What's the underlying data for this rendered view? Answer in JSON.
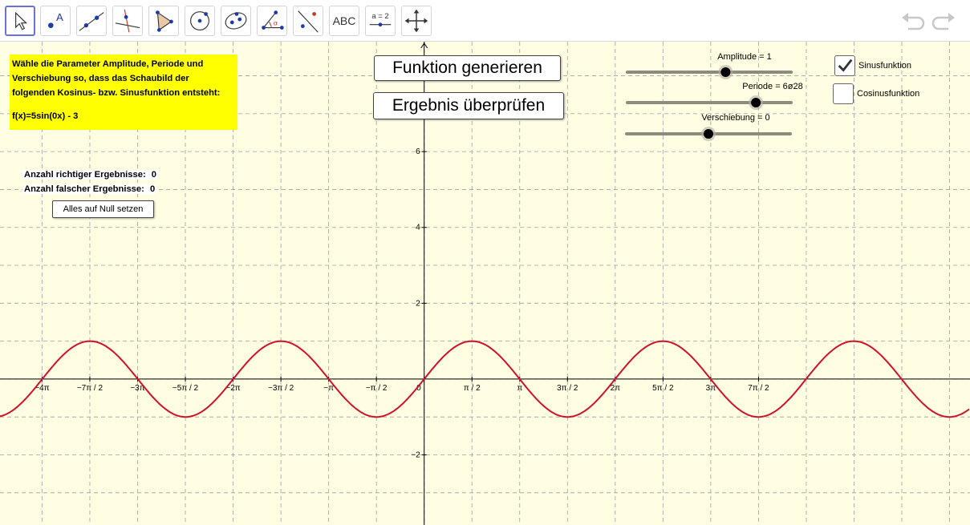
{
  "toolbar": {
    "tools": [
      {
        "name": "move-tool",
        "icon": "cursor-arrow-icon"
      },
      {
        "name": "point-tool",
        "icon": "point-icon",
        "text": "A"
      },
      {
        "name": "line-tool",
        "icon": "line-through-points-icon"
      },
      {
        "name": "perpendicular-line-tool",
        "icon": "perpendicular-line-icon"
      },
      {
        "name": "polygon-tool",
        "icon": "polygon-icon"
      },
      {
        "name": "circle-tool",
        "icon": "circle-center-point-icon"
      },
      {
        "name": "conic-tool",
        "icon": "ellipse-icon"
      },
      {
        "name": "angle-tool",
        "icon": "angle-icon",
        "text": "α"
      },
      {
        "name": "reflect-tool",
        "icon": "reflect-about-line-icon"
      },
      {
        "name": "text-tool",
        "icon": "text-icon",
        "text": "ABC"
      },
      {
        "name": "slider-tool",
        "icon": "slider-icon",
        "text": "a = 2"
      },
      {
        "name": "move-graphics-tool",
        "icon": "move-graphics-view-icon"
      }
    ],
    "undo_icon": "undo-icon",
    "redo_icon": "redo-icon"
  },
  "task": {
    "lines": [
      "Wähle die Parameter Amplitude, Periode und",
      "Verschiebung so, dass das Schaubild der",
      "folgenden Kosinus- bzw. Sinusfunktion entsteht:"
    ],
    "formula": "f(x)=5sin(0x) - 3"
  },
  "buttons": {
    "generate": "Funktion generieren",
    "check": "Ergebnis überprüfen",
    "reset": "Alles auf Null setzen"
  },
  "counters": {
    "correct_label": "Anzahl richtiger Ergebnisse:",
    "correct_value": "0",
    "wrong_label": "Anzahl falscher Ergebnisse:",
    "wrong_value": "0"
  },
  "sliders": [
    {
      "label": "Amplitude = 1",
      "value": 1,
      "min": -5,
      "max": 5
    },
    {
      "label": "Periode = 6ø28",
      "value": 6.28,
      "min": 0,
      "max": 8
    },
    {
      "label": "Verschiebung = 0",
      "value": 0,
      "min": -5,
      "max": 5
    }
  ],
  "checkboxes": [
    {
      "label": "Sinusfunktion",
      "checked": true
    },
    {
      "label": "Cosinusfunktion",
      "checked": false
    }
  ],
  "chart_data": {
    "type": "line",
    "function": "sin(x)",
    "amplitude": 1,
    "period": 6.28,
    "shift": 0,
    "xlim": [
      -13.95,
      17.95
    ],
    "ylim": [
      -3.85,
      8.9
    ],
    "x_tick_labels": [
      "−4π",
      "−7π / 2",
      "−3π",
      "−5π / 2",
      "−2π",
      "−3π / 2",
      "−π",
      "−π / 2",
      "0",
      "π / 2",
      "π",
      "3π / 2",
      "2π",
      "5π / 2",
      "3π",
      "7π / 2"
    ],
    "x_tick_values": [
      -12.566,
      -10.996,
      -9.425,
      -7.854,
      -6.283,
      -4.712,
      -3.142,
      -1.571,
      0,
      1.571,
      3.142,
      4.712,
      6.283,
      7.854,
      9.425,
      10.996
    ],
    "y_tick_labels": [
      "−2",
      "2",
      "4",
      "6"
    ],
    "y_tick_values": [
      -2,
      2,
      4,
      6
    ],
    "grid": true,
    "colors": {
      "curve": "#d0112b",
      "grid": "#a0a0a0",
      "axis": "#000000",
      "background": "#fffde2"
    }
  }
}
